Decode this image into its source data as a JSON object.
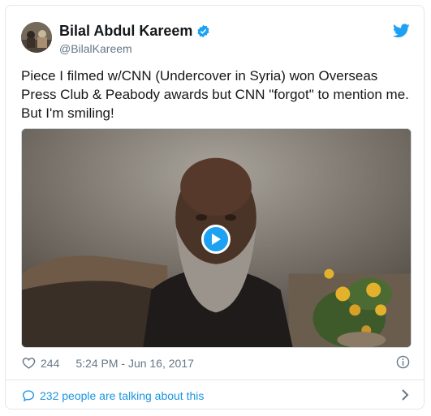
{
  "author": {
    "name": "Bilal Abdul Kareem",
    "handle": "@BilalKareem",
    "verified_icon": "verified-badge-icon",
    "avatar_icon": "avatar"
  },
  "tweet": {
    "text": "Piece I filmed w/CNN (Undercover in Syria) won Overseas Press Club & Peabody awards but CNN \"forgot\" to mention me. But I'm smiling!",
    "media_icon": "play-icon"
  },
  "meta": {
    "likes": "244",
    "timestamp": "5:24 PM - Jun 16, 2017"
  },
  "footer": {
    "talking": "232 people are talking about this"
  },
  "colors": {
    "accent": "#1da1f2",
    "link": "#1b95e0",
    "secondary_text": "#657786",
    "border": "#e1e8ed"
  }
}
